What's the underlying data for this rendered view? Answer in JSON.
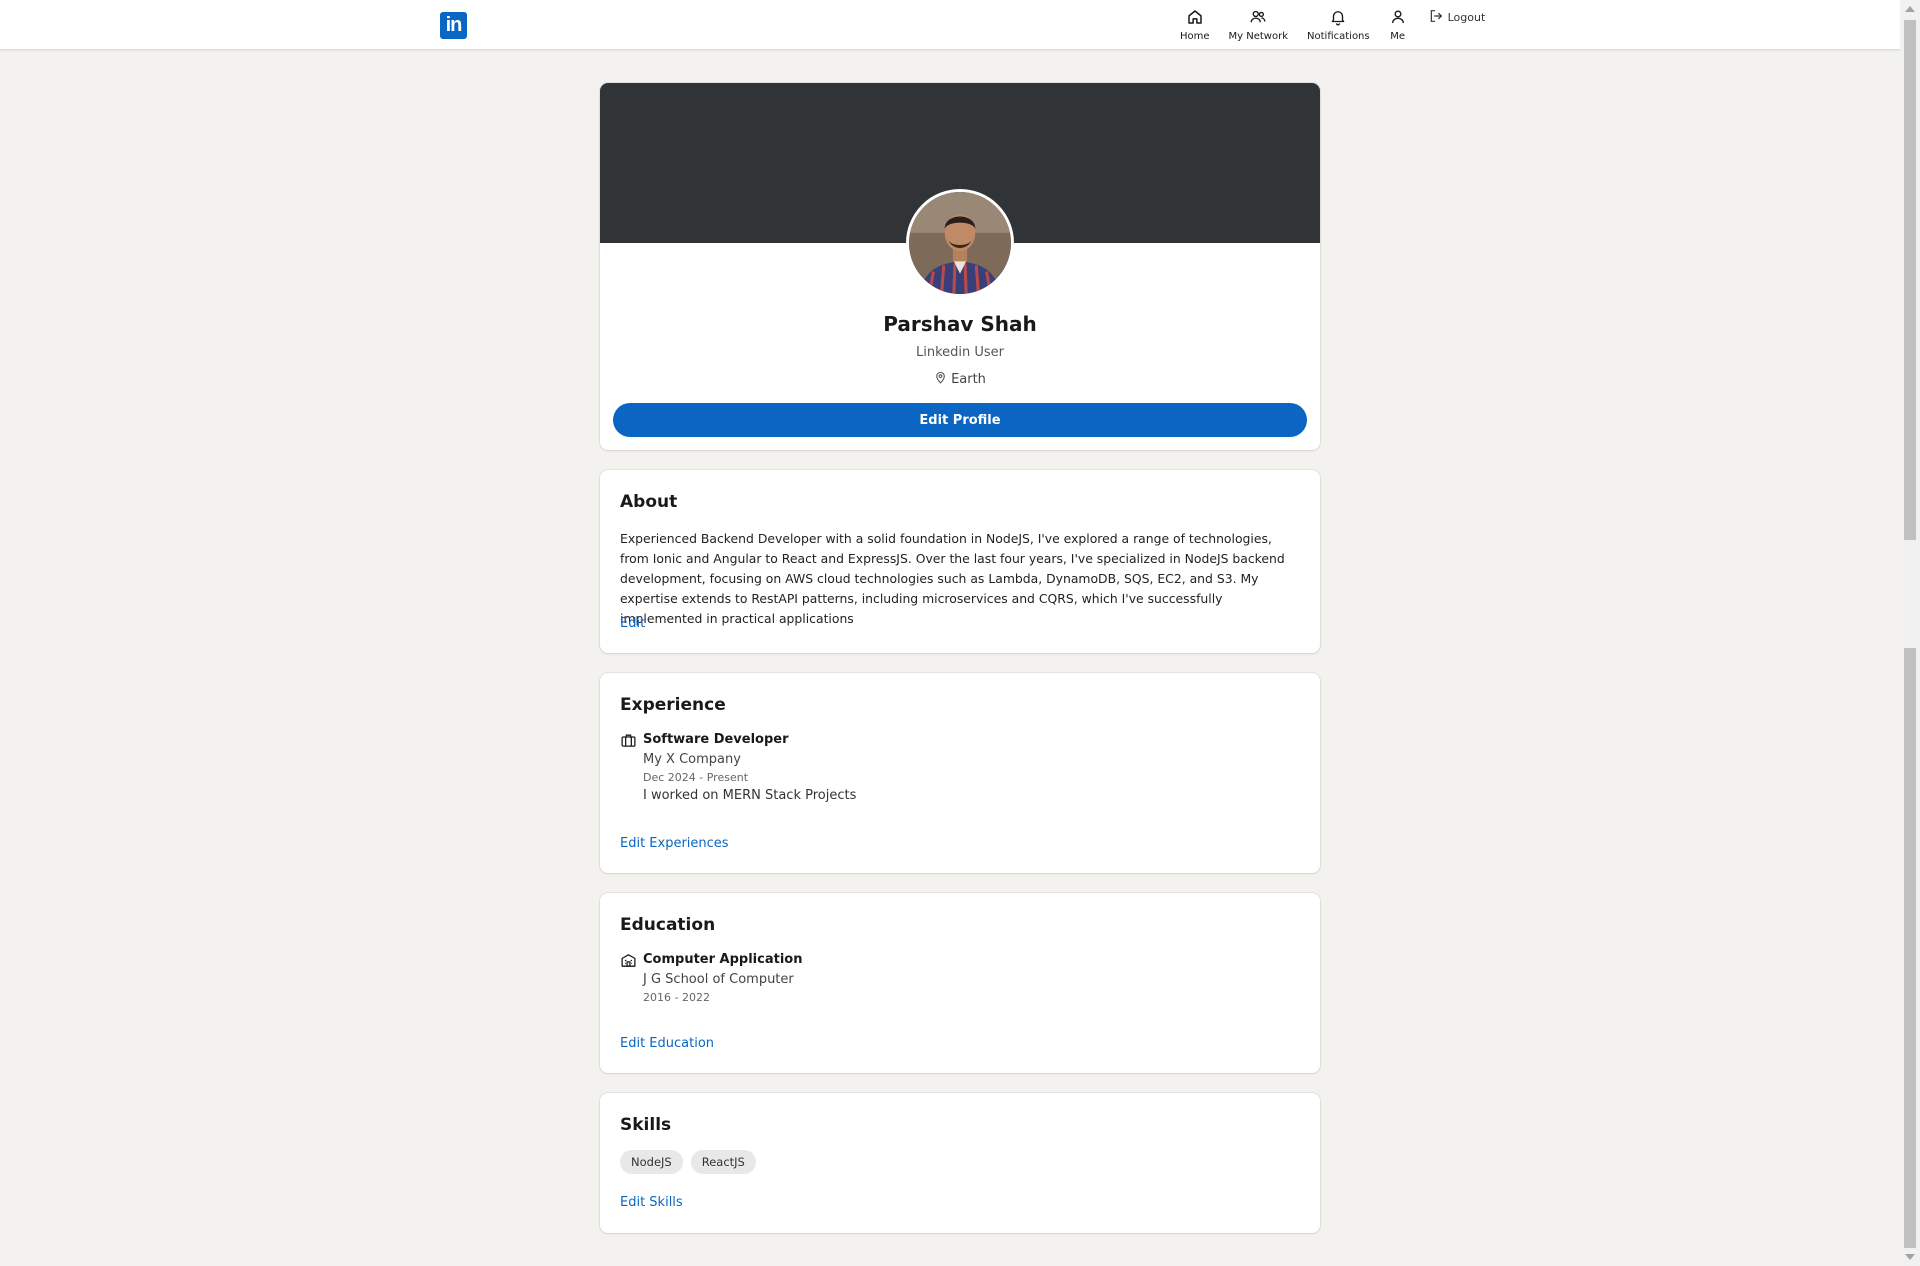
{
  "nav": {
    "logo_text": "in",
    "items": [
      {
        "label": "Home",
        "icon": "home-icon"
      },
      {
        "label": "My Network",
        "icon": "network-icon"
      },
      {
        "label": "Notifications",
        "icon": "bell-icon"
      },
      {
        "label": "Me",
        "icon": "user-icon"
      }
    ],
    "logout_label": "Logout"
  },
  "colors": {
    "accent": "#0a66c2",
    "banner": "#313437",
    "background": "#f3f2ef"
  },
  "profile": {
    "name": "Parshav Shah",
    "headline": "Linkedin User",
    "location": "Earth",
    "edit_label": "Edit Profile"
  },
  "about": {
    "title": "About",
    "text": "Experienced Backend Developer with a solid foundation in NodeJS, I've explored a range of technologies, from Ionic and Angular to React and ExpressJS. Over the last four years, I've specialized in NodeJS backend development, focusing on AWS cloud technologies such as Lambda, DynamoDB, SQS, EC2, and S3. My expertise extends to RestAPI patterns, including microservices and CQRS, which I've successfully implemented in practical applications",
    "edit_label": "Edit"
  },
  "experience": {
    "title": "Experience",
    "items": [
      {
        "title": "Software Developer",
        "company": "My X Company",
        "dates": "Dec 2024 - Present",
        "description": "I worked on MERN Stack Projects"
      }
    ],
    "edit_label": "Edit Experiences"
  },
  "education": {
    "title": "Education",
    "items": [
      {
        "degree": "Computer Application",
        "school": "J G School of Computer",
        "dates": "2016 - 2022"
      }
    ],
    "edit_label": "Edit Education"
  },
  "skills": {
    "title": "Skills",
    "items": [
      "NodeJS",
      "ReactJS"
    ],
    "edit_label": "Edit Skills"
  }
}
